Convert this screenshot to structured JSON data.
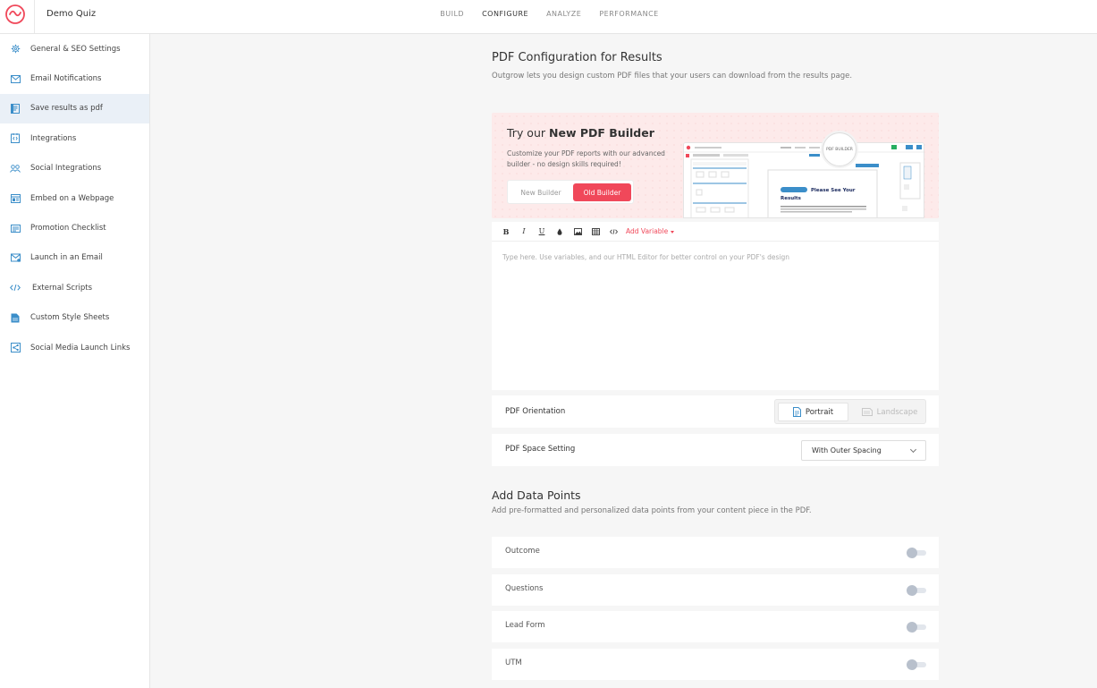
{
  "app": {
    "title": "Demo Quiz",
    "brand_color": "#f0485a"
  },
  "nav": {
    "tabs": [
      {
        "label": "BUILD"
      },
      {
        "label": "CONFIGURE",
        "active": true
      },
      {
        "label": "ANALYZE"
      },
      {
        "label": "PERFORMANCE"
      }
    ]
  },
  "sidebar": {
    "items": [
      {
        "label": "General & SEO Settings",
        "icon": "gear-icon"
      },
      {
        "label": "Email Notifications",
        "icon": "envelope-icon"
      },
      {
        "label": "Save results as pdf",
        "icon": "pdf-icon",
        "active": true
      },
      {
        "label": "Integrations",
        "icon": "integration-icon"
      },
      {
        "label": "Social Integrations",
        "icon": "people-icon"
      },
      {
        "label": "Embed on a Webpage",
        "icon": "embed-icon"
      },
      {
        "label": "Promotion Checklist",
        "icon": "checklist-icon"
      },
      {
        "label": "Launch in an Email",
        "icon": "mail-launch-icon"
      },
      {
        "label": "External Scripts",
        "icon": "code-icon"
      },
      {
        "label": "Custom Style Sheets",
        "icon": "stylesheet-icon"
      },
      {
        "label": "Social Media Launch Links",
        "icon": "share-icon"
      }
    ]
  },
  "pdf_config": {
    "title": "PDF Configuration for Results",
    "subtitle": "Outgrow lets you design custom PDF files that your users can download from the results page.",
    "promo": {
      "title_prefix": "Try our ",
      "title_bold": "New PDF Builder",
      "description": "Customize your PDF reports with our advanced builder - no design skills required!",
      "new_builder_label": "New Builder",
      "old_builder_label": "Old Builder",
      "preview_badge": "PDF BUILDER",
      "preview_heading": "Please See Your Results"
    },
    "editor": {
      "add_variable_label": "Add Variable",
      "placeholder": "Type here. Use variables, and our HTML Editor for better control on your PDF's design"
    },
    "orientation": {
      "label": "PDF Orientation",
      "portrait_label": "Portrait",
      "landscape_label": "Landscape",
      "selected": "Portrait"
    },
    "space_setting": {
      "label": "PDF Space Setting",
      "value": "With Outer Spacing"
    }
  },
  "data_points": {
    "title": "Add Data Points",
    "subtitle": "Add pre-formatted and personalized data points from your content piece in the PDF.",
    "items": [
      {
        "label": "Outcome",
        "enabled": false
      },
      {
        "label": "Questions",
        "enabled": false
      },
      {
        "label": "Lead Form",
        "enabled": false
      },
      {
        "label": "UTM",
        "enabled": false
      }
    ]
  }
}
